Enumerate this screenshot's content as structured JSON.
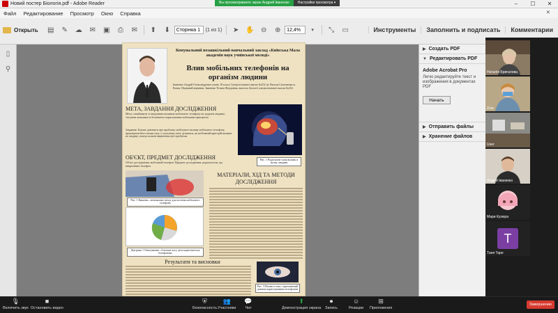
{
  "window": {
    "title": "Новий постер Біологія.pdf - Adobe Reader",
    "close": "✕"
  },
  "share_bar": {
    "message": "Вы просматриваете экран Андрей Іваненко",
    "options": "Настройки просмотра ▾"
  },
  "menu": [
    "Файл",
    "Редактирование",
    "Просмотр",
    "Окно",
    "Справка"
  ],
  "toolbar": {
    "open_label": "Открыть",
    "page_value": "Сторінка 1",
    "page_count": "(1 из 1)",
    "zoom_value": "12,4%",
    "right_links": [
      "Инструменты",
      "Заполнить и подписать",
      "Комментарии"
    ]
  },
  "right_panel": {
    "sections": [
      {
        "label": "Создать PDF",
        "arrow": "▶"
      },
      {
        "label": "Редактировать PDF",
        "arrow": "▼"
      },
      {
        "label": "Отправить файлы",
        "arrow": "▶"
      },
      {
        "label": "Хранение файлов",
        "arrow": "▶"
      }
    ],
    "acrobat_title": "Adobe Acrobat Pro",
    "acrobat_desc": "Легко редактируйте текст и изображения в документах PDF",
    "start_button": "Начать"
  },
  "participants": [
    {
      "name": "Наталія Бригалова",
      "color": "#8b7355"
    },
    {
      "name": "Zoia",
      "color": "#9c8a70"
    },
    {
      "name": "User",
      "color": "#6a6a6a"
    },
    {
      "name": "Андрій Іваненко",
      "color": "#9a8a78"
    },
    {
      "name": "Мари Кузюра",
      "color": "#e9c8c0"
    },
    {
      "name": "Таня Таре",
      "initial": "Т",
      "color": "#7b3fa3"
    }
  ],
  "poster": {
    "institution": "Комунальний позашкільний навчальний заклад «Київська Мала академія наук учнівської молоді»",
    "title": "Влив мобільних телефонів на організм людини",
    "authors": "Іваненко Андрій Олександрович учень 10 класу Спеціалізованої школи №252 ім. Василя Симоненка м. Києва. Науковий керівник: Іваненко Тетяна Федорівна, вчитель біології спеціалізованої школи №252.",
    "section1_title": "МЕТА, ЗАВДАННЯ ДОСЛІДЖЕННЯ",
    "section1_text": "Мета: ознайомити зі шкідливим впливом мобільного телефону на здоров'я людини; з'ясувати можливості безпечного користування мобільним пристроєм.",
    "section1_text2": "Завдання: Більше дізнатися про проблему мобільного впливу мобільного телефону, враховуючи його вплив силу з сучасному світі; дізнатися, як мобільний пристрій впливає на людину; пошук шляхів вирішення цієї проблеми.",
    "section2_title": "ОБ'ЄКТ, ПРЕДМЕТ ДОСЛІДЖЕННЯ",
    "section2_text": "Об'єкт дослідження: мобільний телефон. Предмет дослідження: радіочастоти, що випромінює телефон.",
    "caption1": "Рис. 1 Радіочасне поля впливу в мозку людини",
    "section3_title": "МАТЕРІАЛИ, ХІД ТА МЕТОДИ ДОСЛІДЖЕННЯ",
    "caption2": "Рис. 1 Кишеня—неможливе місце для носіння мобільного телефону",
    "caption3": "Діаграма 1 Опитування: «Скільки часу діти користуються телефоном»",
    "section4_title": "Результати та висновки",
    "caption4": "Рис. 3 Вплив в очах, спричинений довгим користуванням телефоном"
  },
  "bottombar": {
    "items": [
      "Включить звук",
      "Остановить видео",
      "Безопасность",
      "Участники",
      "Чат",
      "Демонстрация экрана",
      "Запись",
      "Реакции",
      "Приложения"
    ],
    "end": "Завершение"
  },
  "colors": {
    "end": "#d73a2f",
    "share_green": "#27a045"
  }
}
